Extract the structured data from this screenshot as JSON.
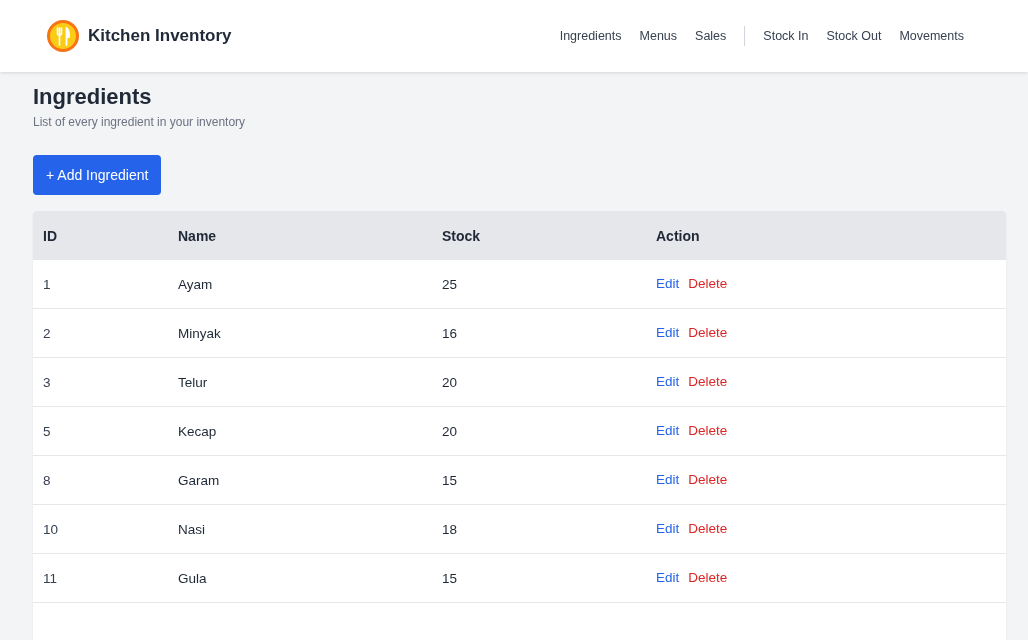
{
  "header": {
    "brand": "Kitchen Inventory",
    "nav_groups": [
      [
        "Ingredients",
        "Menus",
        "Sales"
      ],
      [
        "Stock In",
        "Stock Out",
        "Movements"
      ]
    ]
  },
  "page": {
    "title": "Ingredients",
    "subtitle": "List of every ingredient in your inventory",
    "add_button": "+ Add Ingredient"
  },
  "table": {
    "columns": [
      "ID",
      "Name",
      "Stock",
      "Action"
    ],
    "rows": [
      {
        "id": "1",
        "name": "Ayam",
        "stock": "25",
        "actions": [
          {
            "kind": "edit",
            "label": "Edit"
          },
          {
            "kind": "delete",
            "label": "Delete"
          }
        ]
      },
      {
        "id": "2",
        "name": "Minyak",
        "stock": "16",
        "actions": [
          {
            "kind": "edit",
            "label": "Edit"
          },
          {
            "kind": "delete",
            "label": "Delete"
          }
        ]
      },
      {
        "id": "3",
        "name": "Telur",
        "stock": "20",
        "actions": [
          {
            "kind": "edit",
            "label": "Edit"
          },
          {
            "kind": "delete",
            "label": "Delete"
          }
        ]
      },
      {
        "id": "5",
        "name": "Kecap",
        "stock": "20",
        "actions": [
          {
            "kind": "edit",
            "label": "Edit"
          },
          {
            "kind": "delete",
            "label": "Delete"
          }
        ]
      },
      {
        "id": "8",
        "name": "Garam",
        "stock": "15",
        "actions": [
          {
            "kind": "edit",
            "label": "Edit"
          },
          {
            "kind": "delete",
            "label": "Delete"
          }
        ]
      },
      {
        "id": "10",
        "name": "Nasi",
        "stock": "18",
        "actions": [
          {
            "kind": "edit",
            "label": "Edit"
          },
          {
            "kind": "delete",
            "label": "Delete"
          }
        ]
      },
      {
        "id": "11",
        "name": "Gula",
        "stock": "15",
        "actions": [
          {
            "kind": "edit",
            "label": "Edit"
          },
          {
            "kind": "delete",
            "label": "Delete"
          }
        ]
      }
    ]
  }
}
